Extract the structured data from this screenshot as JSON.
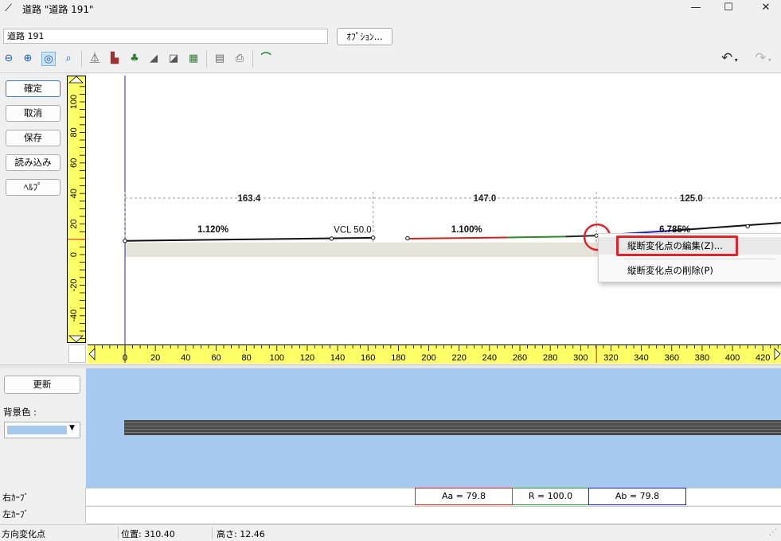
{
  "window": {
    "title": "道路 \"道路 191\"",
    "minimize": "—",
    "maximize": "☐",
    "close": "✕"
  },
  "name_field": {
    "value": "道路 191"
  },
  "options_button": "ｵﾌﾟｼｮﾝ...",
  "toolbar": {
    "icons": [
      "zoom-out-icon",
      "zoom-in-icon",
      "zoom-fit-icon",
      "zoom-window-icon",
      "road-shape-icon",
      "road-surface-icon",
      "road-tree-icon",
      "road-side-icon",
      "road-lane-icon",
      "road-texture-icon",
      "document-icon",
      "print-icon",
      "profile-view-icon"
    ],
    "undo": "↶",
    "redo": "↷"
  },
  "side_buttons": [
    "確定",
    "取消",
    "保存",
    "読み込み",
    "ﾍﾙﾌﾟ"
  ],
  "lower_buttons": {
    "update": "更新",
    "bg_color_label": "背景色 :"
  },
  "chart_data": {
    "type": "line",
    "title": "",
    "xlabel": "",
    "ylabel": "",
    "x_ticks": [
      0,
      20,
      40,
      60,
      80,
      100,
      120,
      140,
      160,
      180,
      200,
      220,
      240,
      260,
      280,
      300,
      320,
      340,
      360,
      380,
      400,
      420
    ],
    "y_ticks": [
      100,
      80,
      60,
      40,
      20,
      0,
      -20,
      -40
    ],
    "xlim": [
      -24,
      432
    ],
    "ylim": [
      -58,
      112
    ],
    "profile": [
      {
        "x": 0,
        "y": 9.0
      },
      {
        "x": 163.4,
        "y": 11.0
      },
      {
        "x": 310.4,
        "y": 12.46
      },
      {
        "x": 435,
        "y": 21.0
      }
    ],
    "section_lengths": [
      {
        "label": "163.4",
        "x": 81.7
      },
      {
        "label": "147.0",
        "x": 236.9
      },
      {
        "label": "125.0",
        "x": 372.9
      }
    ],
    "dim_line_y": 37,
    "grades": [
      {
        "label": "1.120%",
        "x": 58
      },
      {
        "label": "1.100%",
        "x": 225
      },
      {
        "label": "6.785%",
        "x": 362
      }
    ],
    "vcl_label": "VCL  50.0",
    "cursor_x": 310.4
  },
  "context_menu": {
    "edit": "縦断変化点の編集(Z)...",
    "delete": "縦断変化点の削除(P)"
  },
  "curves": {
    "right_label": "右ｶｰﾌﾞ",
    "left_label": "左ｶｰﾌﾞ",
    "items": [
      "Aa = 79.8",
      "R = 100.0",
      "Ab = 79.8"
    ],
    "colors": [
      "#d42020",
      "#2a9a2a",
      "#2020c8"
    ]
  },
  "status": {
    "mode": "方向変化点",
    "position": "位置: 310.40",
    "height": "高さ: 12.46"
  },
  "accent": "#e0242b"
}
